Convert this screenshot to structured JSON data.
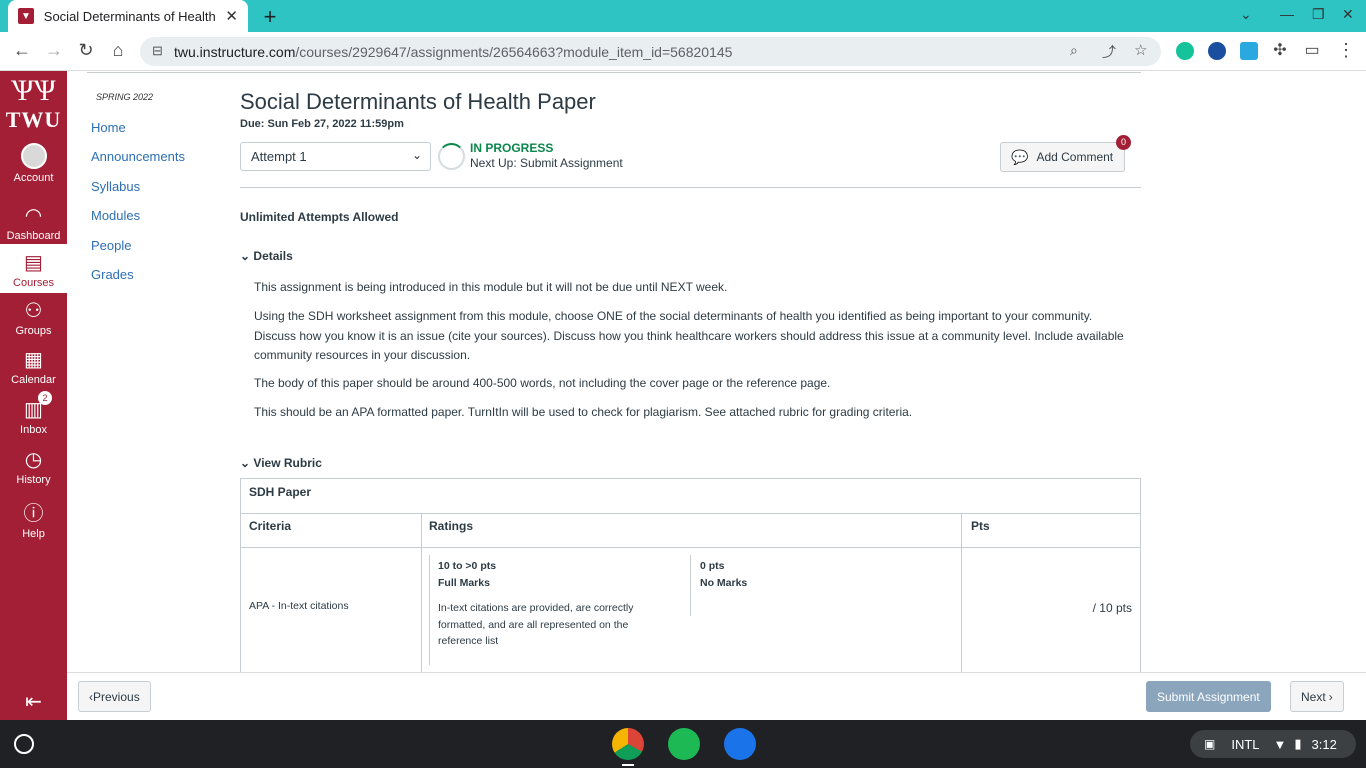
{
  "browser": {
    "tab_title": "Social Determinants of Health P",
    "tab_close": "✕",
    "new_tab": "+",
    "url_host": "twu.instructure.com",
    "url_path": "/courses/2929647/assignments/26564663?module_item_id=56820145"
  },
  "global_nav": {
    "logo_text": "TWU",
    "items": [
      {
        "label": "Account",
        "icon": "account-icon"
      },
      {
        "label": "Dashboard",
        "icon": "dashboard-icon"
      },
      {
        "label": "Courses",
        "icon": "courses-icon"
      },
      {
        "label": "Groups",
        "icon": "groups-icon"
      },
      {
        "label": "Calendar",
        "icon": "calendar-icon"
      },
      {
        "label": "Inbox",
        "icon": "inbox-icon"
      },
      {
        "label": "History",
        "icon": "history-icon"
      },
      {
        "label": "Help",
        "icon": "help-icon"
      }
    ],
    "inbox_badge": "2"
  },
  "course_nav": {
    "term": "SPRING 2022",
    "items": [
      "Home",
      "Announcements",
      "Syllabus",
      "Modules",
      "People",
      "Grades"
    ]
  },
  "assignment": {
    "title": "Social Determinants of Health Paper",
    "due": "Due: Sun Feb 27, 2022 11:59pm",
    "attempt": "Attempt 1",
    "status": "IN PROGRESS",
    "next_up": "Next Up: Submit Assignment",
    "add_comment": "Add Comment",
    "comment_count": "0",
    "attempts_allowed": "Unlimited Attempts Allowed",
    "details_heading": "Details",
    "paragraphs": [
      "This assignment is being introduced in this module but it will not be due until NEXT week.",
      "Using the SDH worksheet assignment from this module, choose ONE of the social determinants of health you identified as being important to your community. Discuss how you know it is an issue (cite your sources). Discuss how you think healthcare workers should address this issue at a community level. Include available community resources in your discussion.",
      "The body of this paper should be around 400-500 words, not including the cover page or the reference page.",
      "This should be an APA formatted paper. TurnItIn will be used to check for plagiarism. See attached rubric for grading criteria."
    ],
    "rubric_heading": "View Rubric"
  },
  "rubric": {
    "title": "SDH Paper",
    "headers": {
      "criteria": "Criteria",
      "ratings": "Ratings",
      "pts": "Pts"
    },
    "rows": [
      {
        "criterion": "APA - In-text citations",
        "ratings": [
          {
            "points": "10 to >0 pts",
            "label": "Full Marks",
            "desc": "In-text citations are provided, are correctly formatted, and are all represented on the reference list"
          },
          {
            "points": "0 pts",
            "label": "No Marks",
            "desc": ""
          }
        ],
        "pts": "/ 10 pts"
      }
    ]
  },
  "footer": {
    "previous": "Previous",
    "submit": "Submit Assignment",
    "next": "Next"
  },
  "shelf": {
    "input_method": "INTL",
    "time": "3:12"
  },
  "colors": {
    "brand": "#a21f35",
    "success": "#0b874b",
    "link": "#2d6fb3",
    "tabbar": "#2ec4c4"
  }
}
